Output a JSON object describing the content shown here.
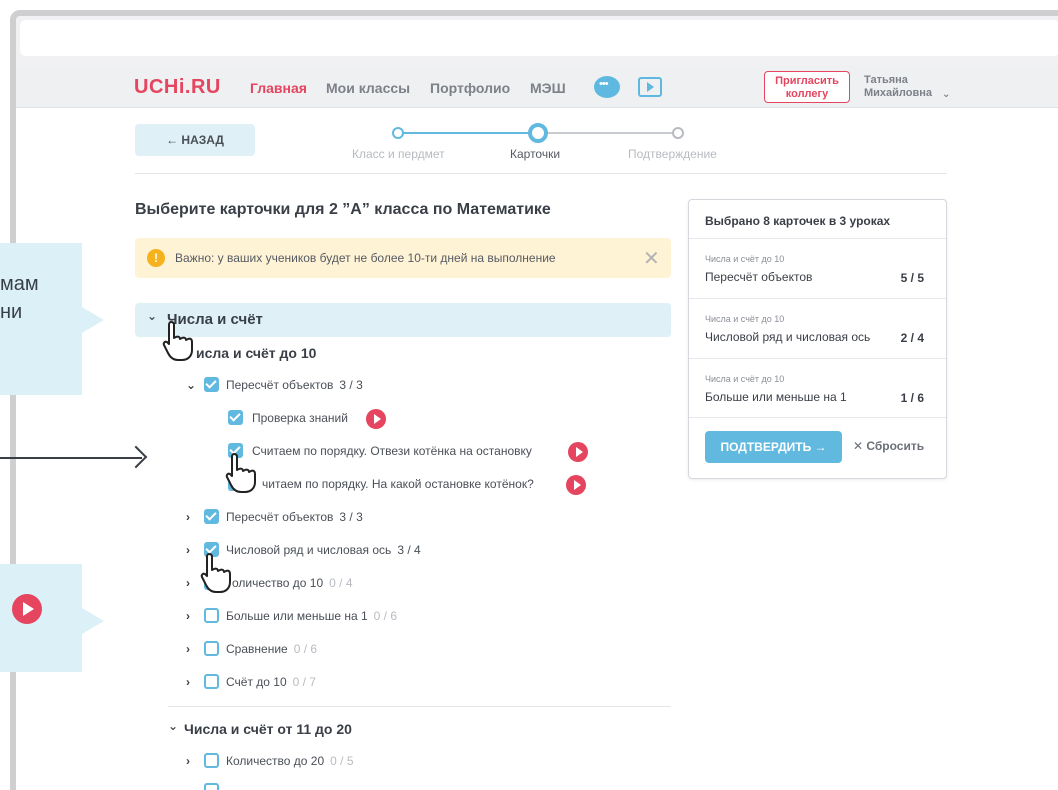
{
  "nav": {
    "logo": "UCHi.RU",
    "links": [
      "Главная",
      "Мои классы",
      "Портфолио",
      "МЭШ"
    ],
    "invite": "Пригласить коллегу",
    "user_first": "Татьяна",
    "user_last": "Михайловна",
    "chevron": "⌄"
  },
  "back": "← НАЗАД",
  "steps": [
    "Класс и пердмет",
    "Карточки",
    "Подтверждение"
  ],
  "heading": "Выберите карточки для 2 ”А” класса по Математике",
  "warning": {
    "icon": "!",
    "text": "Важно: у ваших учеников будет не более 10-ти дней на выполнение",
    "close": "✕"
  },
  "tips": {
    "tip1_line1": "мам",
    "tip1_line2": "ни"
  },
  "section": {
    "title": "Числа и счёт",
    "chevron": "⌄"
  },
  "subsections": [
    "исла и счёт до 10",
    "Числа и счёт от 11 до 20"
  ],
  "rows": [
    {
      "chev": "⌄",
      "label": "Пересчёт объектов",
      "count": "3 / 3"
    },
    {
      "label": "Проверка знаний"
    },
    {
      "label": "Считаем по порядку. Отвези котёнка на остановку"
    },
    {
      "label": "читаем по порядку. На какой остановке котёнок?"
    },
    {
      "chev": "›",
      "label": "Пересчёт объектов",
      "count": "3 / 3"
    },
    {
      "chev": "›",
      "label": "Числовой ряд и числовая ось",
      "count": "3 / 4"
    },
    {
      "chev": "›",
      "label": "оличество до 10",
      "count": "0 / 4"
    },
    {
      "chev": "›",
      "label": "Больше или меньше на 1",
      "count": "0 / 6"
    },
    {
      "chev": "›",
      "label": "Сравнение",
      "count": "0 / 6"
    },
    {
      "chev": "›",
      "label": "Счёт до 10",
      "count": "0 / 7"
    },
    {
      "chev": "›",
      "label": "Количество до 20",
      "count": "0 / 5"
    }
  ],
  "summary": {
    "title": "Выбрано 8 карточек в 3 уроках",
    "items": [
      {
        "category": "Числа и счёт до 10",
        "name": "Пересчёт объектов",
        "count": "5 / 5"
      },
      {
        "category": "Числа и счёт до 10",
        "name": "Числовой ряд и числовая ось",
        "count": "2 / 4"
      },
      {
        "category": "Числа и счёт до 10",
        "name": "Больше или меньше на 1",
        "count": "1 / 6"
      }
    ],
    "confirm": "ПОДТВЕРДИТЬ →",
    "reset": "✕ Сбросить"
  },
  "colors": {
    "brand": "#e5455f",
    "accent": "#62b9e0",
    "warning_bg": "#fff3d6",
    "section_bg": "#dff0f7"
  }
}
